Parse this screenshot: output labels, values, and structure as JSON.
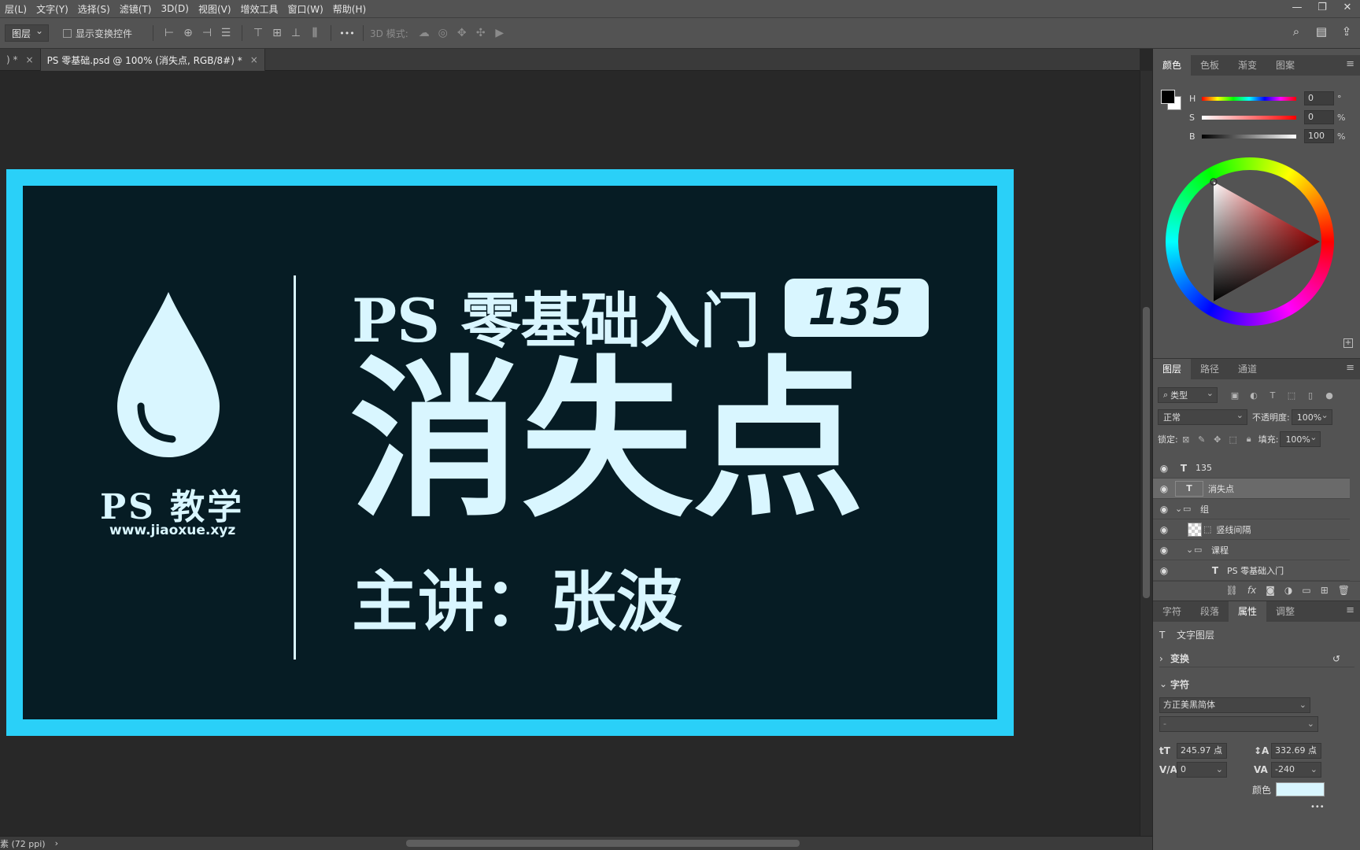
{
  "menubar": {
    "items": [
      "层(L)",
      "文字(Y)",
      "选择(S)",
      "滤镜(T)",
      "3D(D)",
      "视图(V)",
      "增效工具",
      "窗口(W)",
      "帮助(H)"
    ],
    "window_controls": [
      "—",
      "❐",
      "✕"
    ]
  },
  "options": {
    "auto_select_value": "图层",
    "show_transform_label": "显示变换控件",
    "more_glyph": "•••",
    "mode3d_label": "3D 模式:"
  },
  "tabs": [
    {
      "label": ") *",
      "close": "×"
    },
    {
      "label": "PS 零基础.psd @ 100% (消失点, RGB/8#) *",
      "close": "×"
    }
  ],
  "artboard": {
    "logo_caption": "PS 教学",
    "logo_url": "www.jiaoxue.xyz",
    "title_line": "PS 零基础入门",
    "badge_number": "135",
    "big_title": "消失点",
    "speaker": "主讲：张波",
    "colors": {
      "border": "#2ad0f8",
      "bg": "#061c24",
      "text": "#d9f6ff"
    }
  },
  "status": {
    "zoom_text": "素 (72 ppi)",
    "arrow": "›"
  },
  "color_panel": {
    "tabs": [
      "颜色",
      "色板",
      "渐变",
      "图案"
    ],
    "active_tab": "颜色",
    "sliders": [
      {
        "label": "H",
        "value": "0",
        "unit": "°"
      },
      {
        "label": "S",
        "value": "0",
        "unit": "%"
      },
      {
        "label": "B",
        "value": "100",
        "unit": "%"
      }
    ]
  },
  "layers_panel": {
    "tabs": [
      "图层",
      "路径",
      "通道"
    ],
    "active_tab": "图层",
    "filter_label": "类型",
    "blend_mode": "正常",
    "opacity_label": "不透明度:",
    "opacity_value": "100%",
    "lock_label": "锁定:",
    "fill_label": "填充:",
    "fill_value": "100%",
    "layers": [
      {
        "name": "135",
        "kind": "T",
        "selected": false,
        "indent": 0
      },
      {
        "name": "消失点",
        "kind": "T",
        "selected": true,
        "indent": 0
      },
      {
        "name": "组",
        "kind": "folder",
        "selected": false,
        "indent": 0
      },
      {
        "name": "竖线间隔",
        "kind": "shape",
        "selected": false,
        "indent": 1
      },
      {
        "name": "课程",
        "kind": "folder",
        "selected": false,
        "indent": 1
      },
      {
        "name": "PS 零基础入门",
        "kind": "T",
        "selected": false,
        "indent": 2
      }
    ]
  },
  "properties_panel": {
    "tabs": [
      "字符",
      "段落",
      "属性",
      "调整"
    ],
    "active_tab": "属性",
    "layer_type": "文字图层",
    "transform_section": "变换",
    "character_section": "字符",
    "font_family": "方正美黑简体",
    "font_style": "-",
    "font_size": "245.97 点",
    "leading": "332.69 点",
    "kerning": "0",
    "tracking": "-240",
    "color_label": "颜色",
    "text_color": "#d9f6ff",
    "more_glyph": "•••"
  }
}
